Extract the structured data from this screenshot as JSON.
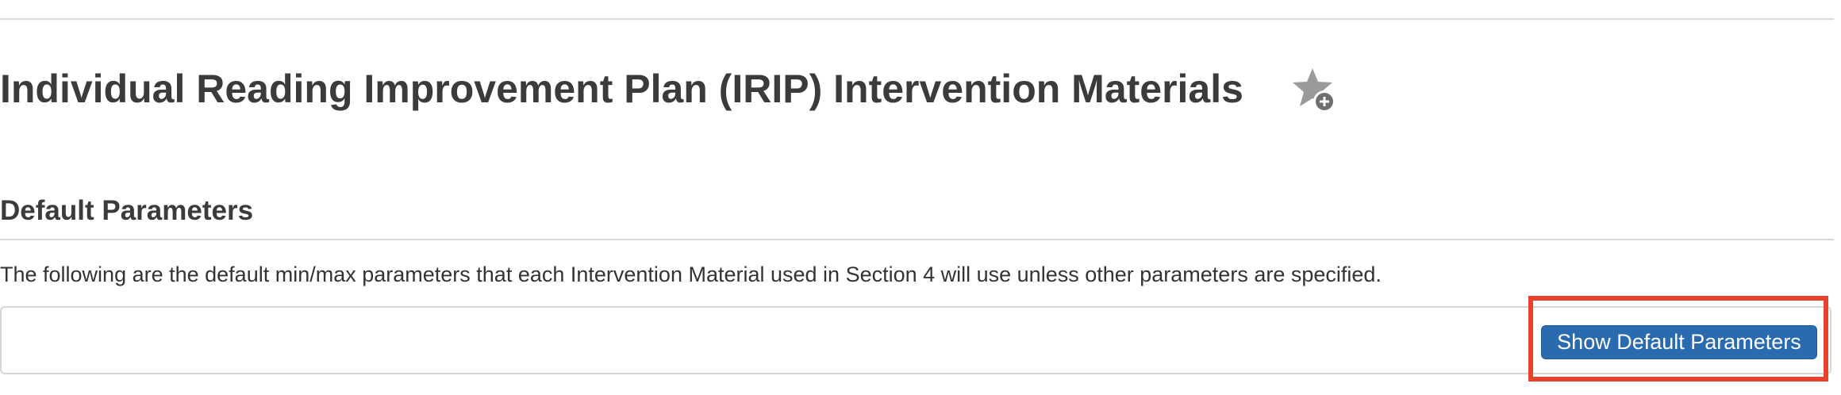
{
  "page": {
    "title": "Individual Reading Improvement Plan (IRIP) Intervention Materials"
  },
  "icons": {
    "favorite": "star-add-icon"
  },
  "section": {
    "title": "Default Parameters",
    "description": "The following are the default min/max parameters that each Intervention Material used in Section 4 will use unless other parameters are specified.",
    "button_label": "Show Default Parameters"
  },
  "colors": {
    "button_background": "#2a6bb0",
    "highlight_outline": "#e8412d",
    "heading_text": "#3b3b3b",
    "icon_gray": "#9a9a9a"
  }
}
